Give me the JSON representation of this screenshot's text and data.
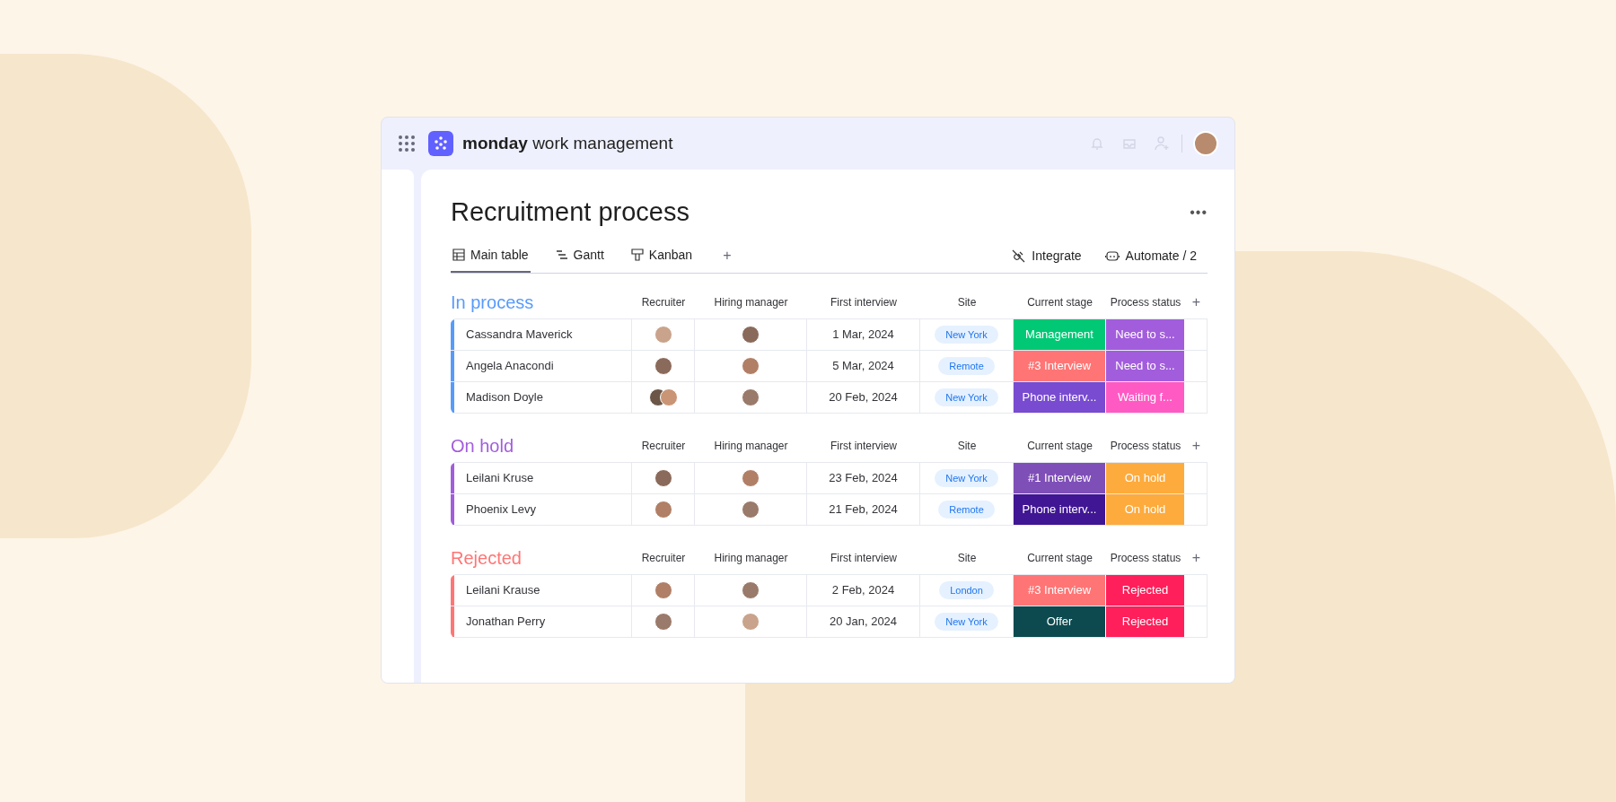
{
  "app": {
    "brand_bold": "monday",
    "brand_rest": "work management"
  },
  "board": {
    "title": "Recruitment process",
    "more": "•••"
  },
  "tabs": [
    {
      "label": "Main table",
      "selected": true
    },
    {
      "label": "Gantt",
      "selected": false
    },
    {
      "label": "Kanban",
      "selected": false
    }
  ],
  "add_tab": "+",
  "actions": [
    {
      "label": "Integrate"
    },
    {
      "label": "Automate / 2"
    }
  ],
  "groups": [
    {
      "title": "In process",
      "color": "#579bfc",
      "columns": [
        "Recruiter",
        "Hiring manager",
        "First interview",
        "Site",
        "Current stage",
        "Process status"
      ],
      "add_column": "+",
      "rows": [
        {
          "name": "Cassandra Maverick",
          "recruiter": {
            "kind": "single"
          },
          "date": "1 Mar, 2024",
          "site": "New York",
          "stage": {
            "text": "Management",
            "color": "#00c875"
          },
          "status": {
            "text": "Need to s...",
            "color": "#a25ddc"
          }
        },
        {
          "name": "Angela Anacondi",
          "recruiter": {
            "kind": "single"
          },
          "date": "5 Mar, 2024",
          "site": "Remote",
          "stage": {
            "text": "#3 Interview",
            "color": "#ff7575"
          },
          "status": {
            "text": "Need to s...",
            "color": "#a25ddc"
          }
        },
        {
          "name": "Madison Doyle",
          "recruiter": {
            "kind": "pair"
          },
          "date": "20 Feb, 2024",
          "site": "New York",
          "stage": {
            "text": "Phone interv...",
            "color": "#784bd1"
          },
          "status": {
            "text": "Waiting f...",
            "color": "#ff5ac4"
          }
        }
      ]
    },
    {
      "title": "On hold",
      "color": "#a25ddc",
      "columns": [
        "Recruiter",
        "Hiring manager",
        "First interview",
        "Site",
        "Current stage",
        "Process status"
      ],
      "add_column": "+",
      "rows": [
        {
          "name": "Leilani Kruse",
          "recruiter": {
            "kind": "single"
          },
          "date": "23 Feb, 2024",
          "site": "New York",
          "stage": {
            "text": "#1 Interview",
            "color": "#7f4fb8"
          },
          "status": {
            "text": "On hold",
            "color": "#fdab3d"
          }
        },
        {
          "name": "Phoenix Levy",
          "recruiter": {
            "kind": "single"
          },
          "date": "21 Feb, 2024",
          "site": "Remote",
          "stage": {
            "text": "Phone interv...",
            "color": "#401694"
          },
          "status": {
            "text": "On hold",
            "color": "#fdab3d"
          }
        }
      ]
    },
    {
      "title": "Rejected",
      "color": "#ff7575",
      "columns": [
        "Recruiter",
        "Hiring manager",
        "First interview",
        "Site",
        "Current stage",
        "Process status"
      ],
      "add_column": "+",
      "rows": [
        {
          "name": "Leilani Krause",
          "recruiter": {
            "kind": "single"
          },
          "date": "2 Feb, 2024",
          "site": "London",
          "stage": {
            "text": "#3 Interview",
            "color": "#ff7575"
          },
          "status": {
            "text": "Rejected",
            "color": "#ff1f5a"
          }
        },
        {
          "name": "Jonathan Perry",
          "recruiter": {
            "kind": "single"
          },
          "date": "20 Jan, 2024",
          "site": "New York",
          "stage": {
            "text": "Offer",
            "color": "#0c4a4f"
          },
          "status": {
            "text": "Rejected",
            "color": "#ff1f5a"
          }
        }
      ]
    }
  ]
}
